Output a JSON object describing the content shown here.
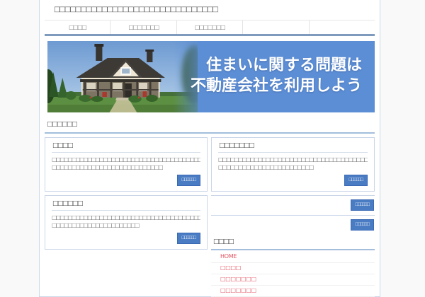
{
  "site": {
    "title": "□□□□□□□□□□□□□□□□□□□□□□□□□□□□□□□"
  },
  "nav": {
    "items": [
      {
        "label": "□□□□"
      },
      {
        "label": "□□□□□□□"
      },
      {
        "label": "□□□□□□□"
      },
      {
        "label": ""
      },
      {
        "label": ""
      }
    ]
  },
  "banner": {
    "heading_line1": "住まいに関する問題は",
    "heading_line2": "不動産会社を利用しよう"
  },
  "main": {
    "section_title": "□□□□□□",
    "left_articles": [
      {
        "title": "□□□□",
        "body_line1": "□□□□□□□□□□□□□□□□□□□□□□□□□□□□□□□□□□□□□□□□□□□□□□□",
        "body_line2": "□□□□□□□□□□□□□□□□□□□□□□□□□□□□",
        "button_label": "□□□□□□"
      },
      {
        "title": "□□□□□□",
        "body_line1": "□□□□□□□□□□□□□□□□□□□□□□□□□□□□□□□□□□□□□□□□□□□□□□",
        "body_line2": "□□□□□□□□□□□□□□□□□□□□□□",
        "button_label": "□□□□□□"
      }
    ],
    "right_article": {
      "title": "□□□□□□□",
      "body_line1": "□□□□□□□□□□□□□□□□□□□□□□□□□□□□□□□□□□□□□□□□□□□□□□□",
      "body_line2": "□□□□□□□□□□□□□□□□□□□□□□□□",
      "button_label": "□□□□□□"
    },
    "more_rows": [
      {
        "button_label": "□□□□□□"
      },
      {
        "button_label": "□□□□□□"
      }
    ],
    "sidebar": {
      "title": "□□□□",
      "links": [
        {
          "label": "HOME"
        },
        {
          "label": "□□□□"
        },
        {
          "label": "□□□□□□□"
        },
        {
          "label": "□□□□□□□"
        }
      ]
    }
  },
  "colors": {
    "accent_button_blue": "#4a7cc4",
    "nav_underline_blue": "#7e9bbd",
    "banner_blue": "#5c8ed6",
    "heading_underline_blue": "#a3bedc",
    "box_border_blue": "#c9d6e8",
    "menu_link_pink": "#e25563"
  }
}
